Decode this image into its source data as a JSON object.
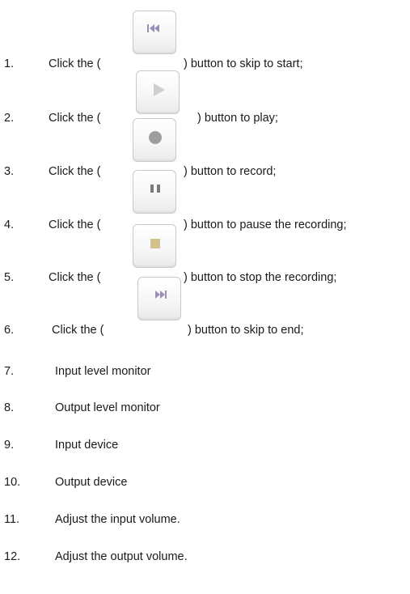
{
  "items": [
    {
      "num": "1.",
      "before": "Click the (",
      "after": ") button to skip to start;",
      "icon": "skip-to-start-icon"
    },
    {
      "num": "2.",
      "before": "Click the (",
      "after": ") button to play;",
      "icon": "play-icon"
    },
    {
      "num": "3.",
      "before": "Click the (",
      "after": ") button to record;",
      "icon": "record-icon"
    },
    {
      "num": "4.",
      "before": "Click the (",
      "after": ") button to pause the recording;",
      "icon": "pause-icon"
    },
    {
      "num": "5.",
      "before": "Click the (",
      "after": ") button to stop the recording;",
      "icon": "stop-icon"
    },
    {
      "num": "6.",
      "before": "Click the (",
      "after": ") button to skip to end;",
      "icon": "skip-to-end-icon"
    },
    {
      "num": "7.",
      "text": "Input level monitor"
    },
    {
      "num": "8.",
      "text": "Output level monitor"
    },
    {
      "num": "9.",
      "text": "Input device"
    },
    {
      "num": "10.",
      "text": "Output device"
    },
    {
      "num": "11.",
      "text": "Adjust the input volume."
    },
    {
      "num": "12.",
      "text": "Adjust the output volume."
    }
  ],
  "colors": {
    "text": "#1a1a1a",
    "button_border": "#c9c9c9",
    "skip_icon": "#9a8fb8",
    "play_icon": "#cfcfcf",
    "record_icon": "#9e9e9e",
    "pause_icon": "#7a7a7a",
    "stop_icon": "#d2c08e"
  }
}
